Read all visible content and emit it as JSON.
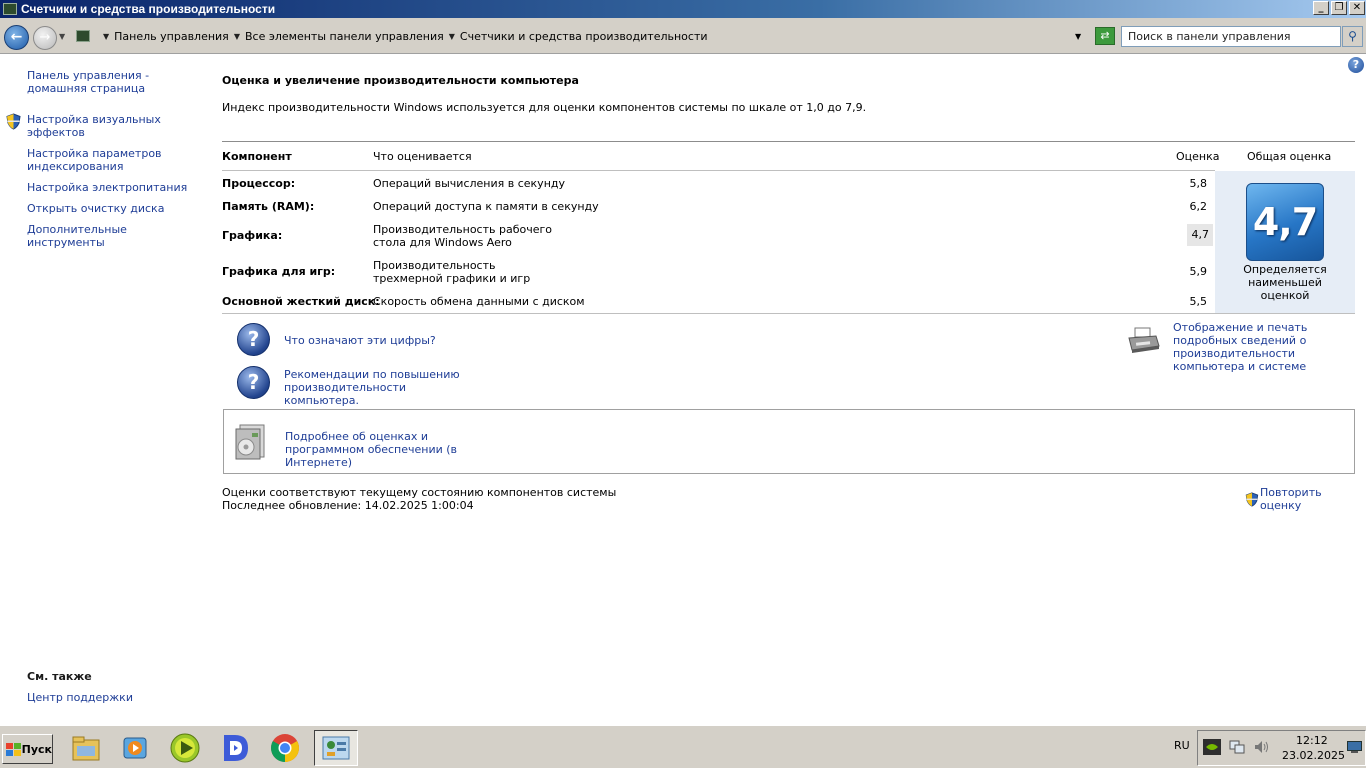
{
  "window": {
    "title": "Счетчики и средства производительности",
    "buttons": {
      "minimize": "_",
      "maximize": "❐",
      "close": "✕"
    }
  },
  "address_bar": {
    "breadcrumbs": [
      "Панель управления",
      "Все элементы панели управления",
      "Счетчики и средства производительности"
    ],
    "search_placeholder": "Поиск в панели управления"
  },
  "left_pane": {
    "links": [
      {
        "label": "Панель управления - домашняя страница"
      },
      {
        "label": "Настройка визуальных эффектов",
        "shield": true
      },
      {
        "label": "Настройка параметров индексирования"
      },
      {
        "label": "Настройка электропитания"
      },
      {
        "label": "Открыть очистку диска"
      },
      {
        "label": "Дополнительные инструменты"
      }
    ],
    "see_also_title": "См. также",
    "see_also_links": [
      "Центр поддержки"
    ]
  },
  "main": {
    "title": "Оценка и увеличение производительности компьютера",
    "description": "Индекс производительности Windows используется для оценки компонентов системы по шкале от 1,0 до 7,9.",
    "headers": {
      "component": "Компонент",
      "what": "Что оценивается",
      "score": "Оценка",
      "base": "Общая оценка"
    },
    "rows": [
      {
        "name": "Процессор:",
        "desc": "Операций вычисления в секунду",
        "score": "5,8"
      },
      {
        "name": "Память (RAM):",
        "desc": "Операций доступа к памяти в секунду",
        "score": "6,2"
      },
      {
        "name": "Графика:",
        "desc": "Производительность рабочего стола для Windows Aero",
        "score": "4,7"
      },
      {
        "name": "Графика для игр:",
        "desc": "Производительность трехмерной графики и игр",
        "score": "5,9"
      },
      {
        "name": "Основной жесткий диск:",
        "desc": "Скорость обмена данными с диском",
        "score": "5,5"
      }
    ],
    "base_score": "4,7",
    "base_caption": "Определяется наименьшей оценкой",
    "links": {
      "what_mean": "Что означают эти цифры?",
      "tips": "Рекомендации по повышению производительности компьютера.",
      "print": "Отображение и печать подробных сведений о производительности компьютера и системе",
      "online": "Подробнее об оценках и программном обеспечении (в Интернете)"
    },
    "status_line1": "Оценки соответствуют текущему состоянию компонентов системы",
    "status_line2": "Последнее обновление: 14.02.2025 1:00:04",
    "rerun": "Повторить оценку"
  },
  "taskbar": {
    "start_label": "Пуск",
    "apps": [
      "explorer-icon",
      "media-player-icon",
      "play-icon",
      "d-app-icon",
      "chrome-icon",
      "control-panel-icon"
    ],
    "language": "RU",
    "time": "12:12",
    "date": "23.02.2025"
  },
  "colors": {
    "link": "#1e3d96",
    "titlebar": "#0a246a",
    "badge": "#2776c6"
  }
}
